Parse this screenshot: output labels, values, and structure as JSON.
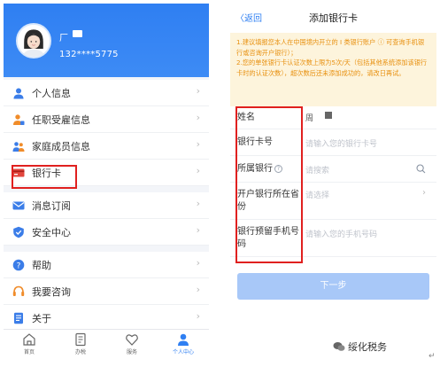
{
  "left_screen": {
    "profile": {
      "name": "厂",
      "phone": "132****5775"
    },
    "menu_groups": [
      [
        {
          "label": "个人信息",
          "icon": "person-icon"
        },
        {
          "label": "任职受雇信息",
          "icon": "employment-icon"
        },
        {
          "label": "家庭成员信息",
          "icon": "family-icon"
        },
        {
          "label": "银行卡",
          "icon": "bank-card-icon"
        }
      ],
      [
        {
          "label": "消息订阅",
          "icon": "mail-icon"
        },
        {
          "label": "安全中心",
          "icon": "shield-icon"
        }
      ],
      [
        {
          "label": "帮助",
          "icon": "help-icon"
        },
        {
          "label": "我要咨询",
          "icon": "headset-icon"
        },
        {
          "label": "关于",
          "icon": "document-icon"
        }
      ]
    ],
    "arrow": "›",
    "tabbar": [
      {
        "label": "首页",
        "icon": "home-icon",
        "active": false
      },
      {
        "label": "办税",
        "icon": "tax-icon",
        "active": false
      },
      {
        "label": "服务",
        "icon": "service-icon",
        "active": false
      },
      {
        "label": "个人中心",
        "icon": "user-center-icon",
        "active": true
      }
    ]
  },
  "right_screen": {
    "back_label": "〈返回",
    "title": "添加银行卡",
    "notice_lines": [
      "1.建议填报您本人在中国境内开立的 I 类银行账户 ⓘ 可查询手机银行或咨询开户银行）；",
      "2.您的单张银行卡认证次数上限为5次/天（包括其他系统添加该银行卡时的认证次数），超次数后还未添加成功的，请改日再试。"
    ],
    "form": {
      "name_label": "姓名",
      "name_value": "周",
      "card_label": "银行卡号",
      "card_placeholder": "请输入您的银行卡号",
      "bank_label": "所属银行",
      "bank_placeholder": "请搜索",
      "province_label": "开户银行所在省份",
      "province_placeholder": "请选择",
      "phone_label": "银行预留手机号码",
      "phone_placeholder": "请输入您的手机号码"
    },
    "next_button": "下一步"
  },
  "watermark": "绥化税务",
  "colors": {
    "primary": "#2f7ff2",
    "highlight_box": "#e0201f",
    "notice_text": "#e8900f",
    "notice_bg": "#fdf4dc",
    "button_disabled": "#a8c8f8"
  }
}
